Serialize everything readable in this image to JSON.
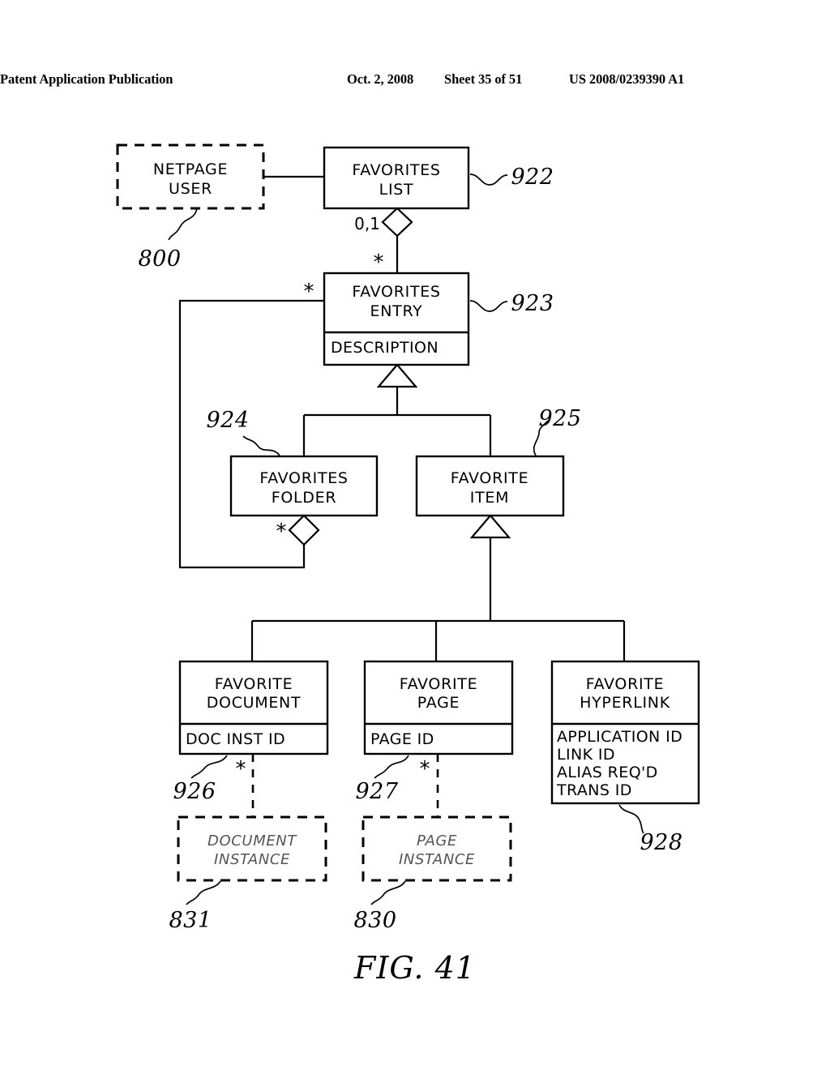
{
  "header": {
    "publication": "Patent Application Publication",
    "date": "Oct. 2, 2008",
    "sheet": "Sheet 35 of 51",
    "number": "US 2008/0239390 A1"
  },
  "figure": {
    "caption": "FIG. 41"
  },
  "diagram": {
    "type": "uml-class-diagram",
    "classes": [
      {
        "id": "netpage-user",
        "name": "NETPAGE USER",
        "lines": [
          "NETPAGE",
          "USER"
        ],
        "style": "dashed",
        "ref": "800"
      },
      {
        "id": "favorites-list",
        "name": "FAVORITES LIST",
        "lines": [
          "FAVORITES",
          "LIST"
        ],
        "style": "solid",
        "ref": "922"
      },
      {
        "id": "favorites-entry",
        "name": "FAVORITES ENTRY",
        "lines": [
          "FAVORITES",
          "ENTRY"
        ],
        "style": "solid",
        "ref": "923",
        "attributes": [
          "DESCRIPTION"
        ]
      },
      {
        "id": "favorites-folder",
        "name": "FAVORITES FOLDER",
        "lines": [
          "FAVORITES",
          "FOLDER"
        ],
        "style": "solid",
        "ref": "924"
      },
      {
        "id": "favorite-item",
        "name": "FAVORITE ITEM",
        "lines": [
          "FAVORITE",
          "ITEM"
        ],
        "style": "solid",
        "ref": "925"
      },
      {
        "id": "favorite-document",
        "name": "FAVORITE DOCUMENT",
        "lines": [
          "FAVORITE",
          "DOCUMENT"
        ],
        "style": "solid",
        "ref": "926",
        "attributes": [
          "DOC INST ID"
        ]
      },
      {
        "id": "favorite-page",
        "name": "FAVORITE PAGE",
        "lines": [
          "FAVORITE",
          "PAGE"
        ],
        "style": "solid",
        "ref": "927",
        "attributes": [
          "PAGE ID"
        ]
      },
      {
        "id": "favorite-hyperlink",
        "name": "FAVORITE HYPERLINK",
        "lines": [
          "FAVORITE",
          "HYPERLINK"
        ],
        "style": "solid",
        "ref": "928",
        "attributes": [
          "APPLICATION ID",
          "LINK ID",
          "ALIAS REQ'D",
          "TRANS ID"
        ]
      },
      {
        "id": "document-instance",
        "name": "DOCUMENT INSTANCE",
        "lines": [
          "DOCUMENT",
          "INSTANCE"
        ],
        "style": "dashed-ghost",
        "ref": "831"
      },
      {
        "id": "page-instance",
        "name": "PAGE INSTANCE",
        "lines": [
          "PAGE",
          "INSTANCE"
        ],
        "style": "dashed-ghost",
        "ref": "830"
      }
    ],
    "multiplicities": {
      "list_to_entry_aggregate": "0,1",
      "list_to_entry_many": "*",
      "entry_to_folder_many": "*",
      "folder_aggregate_many": "*",
      "doc_to_docinstance": "*",
      "page_to_pageinstance": "*"
    }
  }
}
